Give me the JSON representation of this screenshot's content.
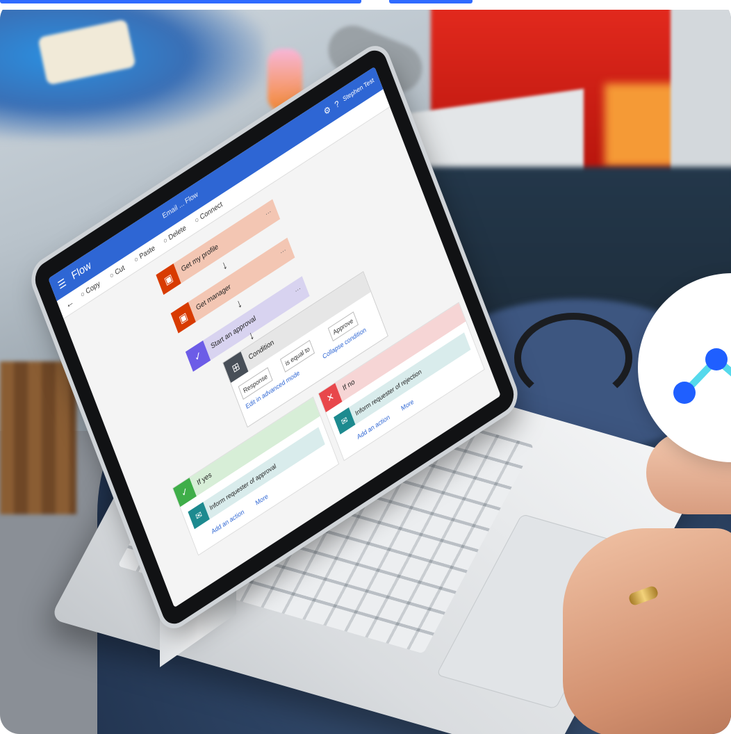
{
  "photo": {
    "laptop_screen": {
      "app_name": "Flow",
      "title": "Email ... Flow",
      "user": "Stephen Test",
      "toolbar": [
        "Copy",
        "Cut",
        "Paste",
        "Delete",
        "Connect"
      ],
      "steps": [
        {
          "label": "Get my profile",
          "color": "#f3c6b3",
          "chip_color": "#d83b01"
        },
        {
          "label": "Get manager",
          "color": "#f3c6b3",
          "chip_color": "#d83b01"
        },
        {
          "label": "Start an approval",
          "color": "#d8d3f0",
          "chip_color": "#6c5ce7"
        }
      ],
      "condition": {
        "label": "Condition",
        "field_1": "Response",
        "field_2": "is equal to",
        "field_3": "Approve",
        "link_1": "Edit in advanced mode",
        "link_2": "Collapse condition"
      },
      "branches": [
        {
          "label": "If yes",
          "color": "#d7eed7",
          "chip_color": "#3fae49",
          "action": "Inform requester of approval",
          "add_action": "Add an action",
          "more": "More"
        },
        {
          "label": "If no",
          "color": "#f6d5d5",
          "chip_color": "#e8474b",
          "action": "Inform requester of rejection",
          "add_action": "Add an action",
          "more": "More"
        }
      ]
    }
  },
  "badge": {
    "icon": "connected-nodes-icon",
    "node_color": "#1f5fff",
    "line_color": "#55d9ec",
    "bg_color": "#ffffff"
  },
  "top_bar_color": "#2f6bff"
}
